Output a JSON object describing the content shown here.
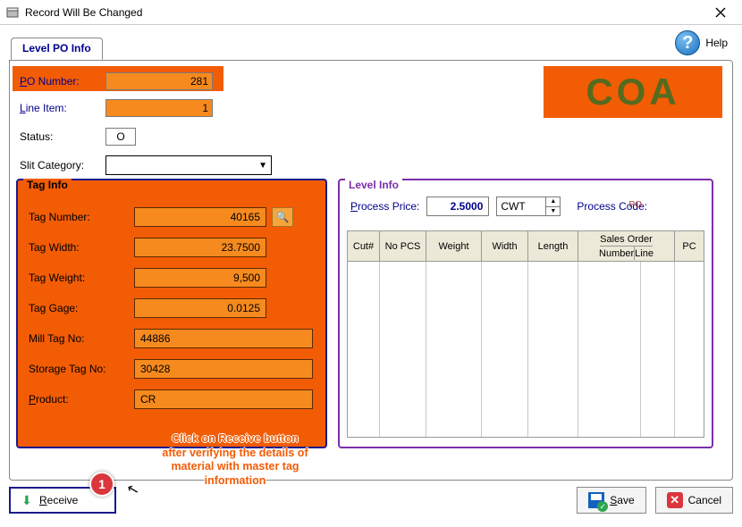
{
  "window": {
    "title": "Record Will Be Changed"
  },
  "tab": {
    "label": "Level PO Info"
  },
  "help": {
    "label": "Help"
  },
  "coa": "COA",
  "po": {
    "po_number_label": "PO Number:",
    "po_number_value": "281",
    "line_item_label": "Line Item:",
    "line_item_value": "1",
    "status_label": "Status:",
    "status_value": "O",
    "slit_label": "Slit Category:",
    "slit_value": ""
  },
  "tag_info": {
    "title": "Tag Info",
    "tag_number_label": "Tag Number:",
    "tag_number_value": "40165",
    "tag_width_label": "Tag Width:",
    "tag_width_value": "23.7500",
    "tag_weight_label": "Tag Weight:",
    "tag_weight_value": "9,500",
    "tag_gage_label": "Tag Gage:",
    "tag_gage_value": "0.0125",
    "mill_tag_label": "Mill Tag No:",
    "mill_tag_value": "44886",
    "storage_tag_label": "Storage Tag No:",
    "storage_tag_value": "30428",
    "product_label": "Product:",
    "product_value": "CR"
  },
  "level_info": {
    "title": "Level Info",
    "process_price_label": "Process Price:",
    "process_price_value": "2.5000",
    "process_price_unit": "CWT",
    "po_mark": "PO",
    "process_code_label": "Process Code:",
    "columns": {
      "cut": "Cut#",
      "no_pcs": "No PCS",
      "weight": "Weight",
      "width": "Width",
      "length": "Length",
      "sales_order": "Sales Order",
      "so_number": "Number",
      "so_line": "Line",
      "pc": "PC"
    }
  },
  "buttons": {
    "receive": "Receive",
    "save": "Save",
    "cancel": "Cancel"
  },
  "annotation": {
    "badge": "1",
    "text": "Click on Receive button after verifying the details of material with master tag information"
  }
}
